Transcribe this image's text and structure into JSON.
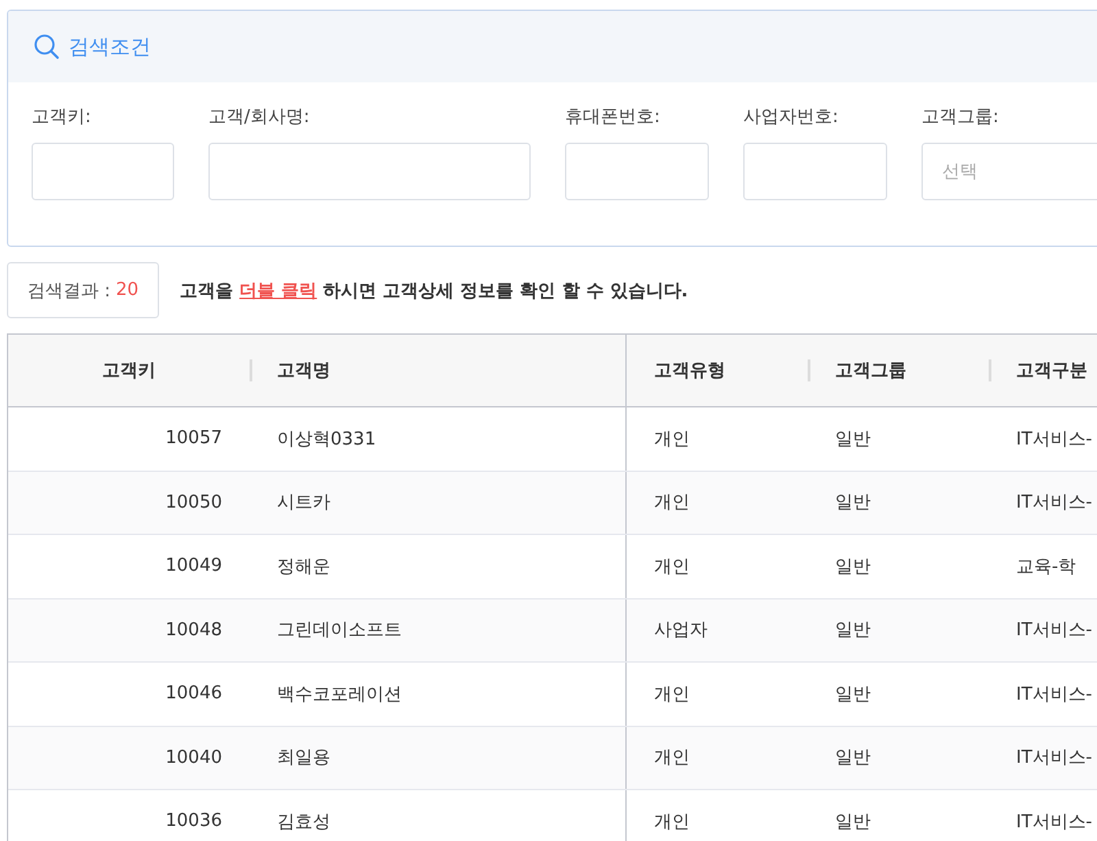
{
  "search_panel": {
    "title": "검색조건",
    "fields": [
      {
        "label": "고객키:",
        "kind": "text"
      },
      {
        "label": "고객/회사명:",
        "kind": "text"
      },
      {
        "label": "휴대폰번호:",
        "kind": "text"
      },
      {
        "label": "사업자번호:",
        "kind": "text"
      },
      {
        "label": "고객그룹:",
        "kind": "select",
        "placeholder": "선택"
      }
    ]
  },
  "result_bar": {
    "label": "검색결과 :",
    "count": "20",
    "message_before": "고객을",
    "link": "더블 클릭",
    "message_after": "하시면 고객상세 정보를 확인 할 수 있습니다."
  },
  "table": {
    "columns": [
      "고객키",
      "고객명",
      "고객유형",
      "고객그룹",
      "고객구분"
    ],
    "rows": [
      [
        "10057",
        "이상혁0331",
        "개인",
        "일반",
        "IT서비스-"
      ],
      [
        "10050",
        "시트카",
        "개인",
        "일반",
        "IT서비스-"
      ],
      [
        "10049",
        "정해운",
        "개인",
        "일반",
        "교육-학"
      ],
      [
        "10048",
        "그린데이소프트",
        "사업자",
        "일반",
        "IT서비스-"
      ],
      [
        "10046",
        "백수코포레이션",
        "개인",
        "일반",
        "IT서비스-"
      ],
      [
        "10040",
        "최일용",
        "개인",
        "일반",
        "IT서비스-"
      ],
      [
        "10036",
        "김효성",
        "개인",
        "일반",
        "IT서비스-"
      ]
    ]
  }
}
